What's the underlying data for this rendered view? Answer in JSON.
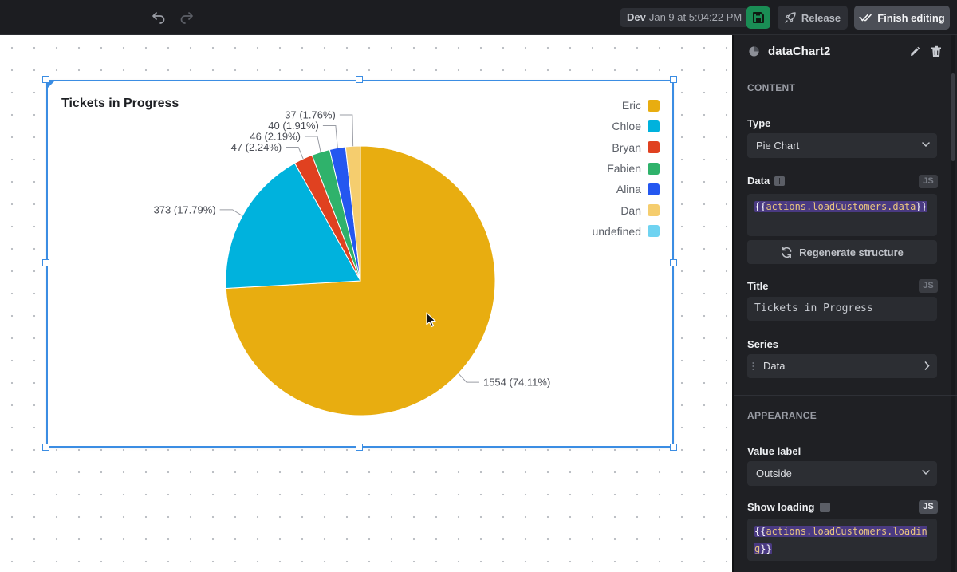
{
  "topbar": {
    "env_label": "Dev",
    "env_time": "Jan 9 at 5:04:22 PM",
    "release_label": "Release",
    "finish_label": "Finish editing"
  },
  "widget": {
    "title": "Tickets in Progress"
  },
  "chart_data": {
    "type": "pie",
    "title": "Tickets in Progress",
    "legend_position": "top-right",
    "value_label_position": "outside",
    "slices": [
      {
        "name": "Eric",
        "value": 1554,
        "label": "1554 (74.11%)",
        "color": "#e8ad10"
      },
      {
        "name": "Chloe",
        "value": 373,
        "label": "373 (17.79%)",
        "color": "#00b2dd"
      },
      {
        "name": "Bryan",
        "value": 47,
        "label": "47 (2.24%)",
        "color": "#e04120"
      },
      {
        "name": "Fabien",
        "value": 46,
        "label": "46 (2.19%)",
        "color": "#2fb26b"
      },
      {
        "name": "Alina",
        "value": 40,
        "label": "40 (1.91%)",
        "color": "#2457f0"
      },
      {
        "name": "Dan",
        "value": 37,
        "label": "37 (1.76%)",
        "color": "#f5cd6e"
      }
    ],
    "legend": [
      {
        "name": "Eric",
        "color": "#e8ad10"
      },
      {
        "name": "Chloe",
        "color": "#00b2dd"
      },
      {
        "name": "Bryan",
        "color": "#e04120"
      },
      {
        "name": "Fabien",
        "color": "#2fb26b"
      },
      {
        "name": "Alina",
        "color": "#2457f0"
      },
      {
        "name": "Dan",
        "color": "#f5cd6e"
      },
      {
        "name": "undefined",
        "color": "#6fd3f1"
      }
    ]
  },
  "panel": {
    "title": "dataChart2",
    "content_heading": "CONTENT",
    "type_label": "Type",
    "type_value": "Pie Chart",
    "data_label": "Data",
    "js_badge": "JS",
    "data_code_open": "{{",
    "data_code_expr": "actions.loadCustomers.data",
    "data_code_close": "}}",
    "regenerate_label": "Regenerate structure",
    "title_label": "Title",
    "title_value": "Tickets in Progress",
    "series_label": "Series",
    "series_item": "Data",
    "appearance_heading": "APPEARANCE",
    "value_label_label": "Value label",
    "value_label_value": "Outside",
    "show_loading_label": "Show loading",
    "loading_code_open": "{{",
    "loading_code_expr": "actions.loadCustomers.loading",
    "loading_code_close": "}}"
  }
}
